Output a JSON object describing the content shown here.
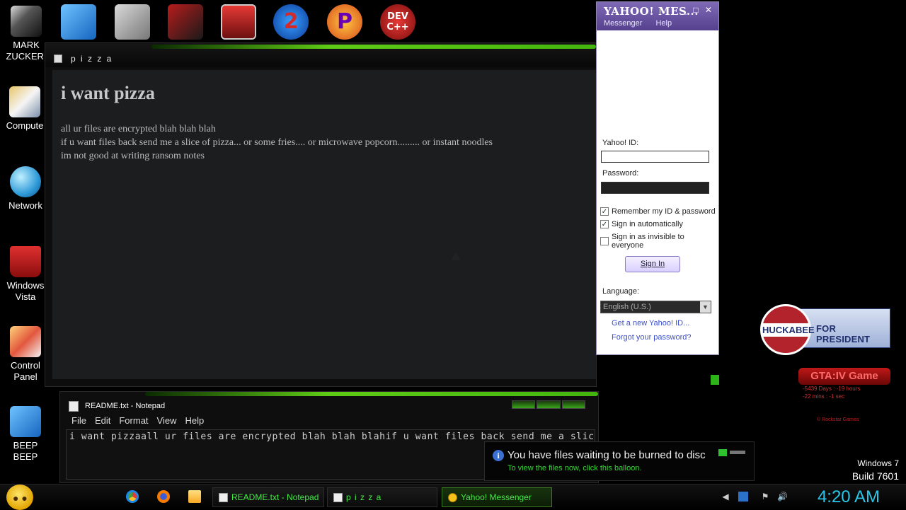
{
  "desktop_icons": [
    {
      "label": "MARK\nZUCKER.",
      "icon": "user-folder-icon"
    },
    {
      "label": "Compute",
      "icon": "computer-icon"
    },
    {
      "label": "Network",
      "icon": "network-globe-icon"
    },
    {
      "label": "Windows\nVista",
      "icon": "recycle-bin-icon"
    },
    {
      "label": "Control\nPanel",
      "icon": "control-panel-icon"
    },
    {
      "label": "BEEP\nBEEP",
      "icon": "blue-drive-icon"
    }
  ],
  "top_icons": [
    {
      "icon": "blue-drive-icon",
      "text": ""
    },
    {
      "icon": "documents-icon",
      "text": ""
    },
    {
      "icon": "star-wars-icon",
      "text": ""
    },
    {
      "icon": "minecraft-block-icon",
      "text": ""
    },
    {
      "icon": "portal-2-icon",
      "text": "2"
    },
    {
      "icon": "p-game-icon",
      "text": "P"
    },
    {
      "icon": "dev-cpp-icon",
      "text": "DEV C++"
    }
  ],
  "pizza_window": {
    "title": "p i z z a",
    "heading": "i want pizza",
    "lines": [
      "all ur files are encrypted blah blah blah",
      "if u want files back send me a slice of pizza... or some fries.... or microwave popcorn......... or instant noodles",
      "im not good at writing ransom notes"
    ]
  },
  "notepad": {
    "title": "README.txt - Notepad",
    "menu": [
      "File",
      "Edit",
      "Format",
      "View",
      "Help"
    ],
    "text": "i want pizzaall ur files are encrypted blah blah blahif u want files back send me a slice o"
  },
  "yahoo": {
    "logo": "YAHOO! MES...",
    "controls": "_ □ ✕",
    "menu": [
      "Messenger",
      "Help"
    ],
    "id_label": "Yahoo! ID:",
    "password_label": "Password:",
    "remember": "Remember my ID & password",
    "auto": "Sign in automatically",
    "invisible": "Sign in as invisible to everyone",
    "remember_checked": true,
    "auto_checked": true,
    "invisible_checked": false,
    "signin": "Sign In",
    "language_label": "Language:",
    "language_value": "English (U.S.)",
    "new_id_link": "Get a new Yahoo! ID...",
    "forgot_link": "Forgot your password?"
  },
  "huckabee": {
    "seal_text": "HUCKABEE",
    "band_text": "FOR PRESIDENT"
  },
  "gta": {
    "title": "GTA:IV Game",
    "line1": "-5439 Days : -19 hours",
    "line2": "-22 mins : -1 sec",
    "footer": "© Rockstar Games"
  },
  "os": {
    "name": "Windows 7",
    "build": "Build 7601"
  },
  "balloon": {
    "title": "You have files waiting to be burned to disc",
    "subtitle": "To view the files now, click this balloon."
  },
  "taskbar": {
    "buttons": [
      "README.txt - Notepad",
      "p i z z a",
      "Yahoo! Messenger"
    ],
    "clock": "4:20 AM"
  },
  "colors": {
    "accent_green": "#5ecb15",
    "clock": "#28c6e8",
    "yahoo_purple": "#6b55a3"
  }
}
